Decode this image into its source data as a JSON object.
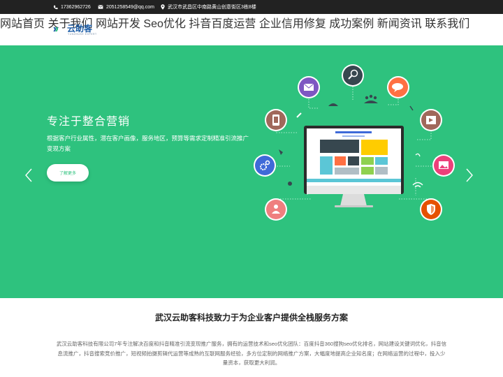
{
  "topbar": {
    "phone": "17362962726",
    "email": "2051258549@qq.com",
    "address": "武汉市武昌区中南路黄山创意街区3栋8楼"
  },
  "logo": {
    "text": "云助客",
    "subtitle": "YUNZHUKE EXPERT"
  },
  "nav": {
    "items": [
      {
        "label": "网站首页"
      },
      {
        "label": "关于我们"
      },
      {
        "label": "网站开发"
      },
      {
        "label": "Seo优化"
      },
      {
        "label": "抖音百度运营"
      },
      {
        "label": "企业信用修复"
      },
      {
        "label": "成功案例"
      },
      {
        "label": "新闻资讯"
      },
      {
        "label": "联系我们"
      }
    ]
  },
  "hero": {
    "title": "专注于整合营销",
    "description": "根据客户行业属性，潜在客户画像，服务地区，预算等需求定制精准引流推广变现方案",
    "button_label": "了解更多"
  },
  "intro": {
    "title": "武汉云助客科技致力于为企业客户提供全栈服务方案",
    "description": "武汉云助客科技有限公司7年专注解决百度和抖音精准引流变现推广服务，拥有的运营技术和seo优化团队：百度抖音360搜狗seo优化排名，网站建设关键词优化，抖音信息流推广，抖音搜索竞价推广，短视频拍摄剪辑代运营等成熟的互联网服务经验，多方位定制的网络推广方案，大幅度地提高企业知名度；在网络运营的过程中，投入少量资本，获取更大利润。"
  },
  "colors": {
    "topbar": "#222222",
    "hero_bg": "#2ec27e",
    "logo_blue": "#1f5fa8"
  }
}
